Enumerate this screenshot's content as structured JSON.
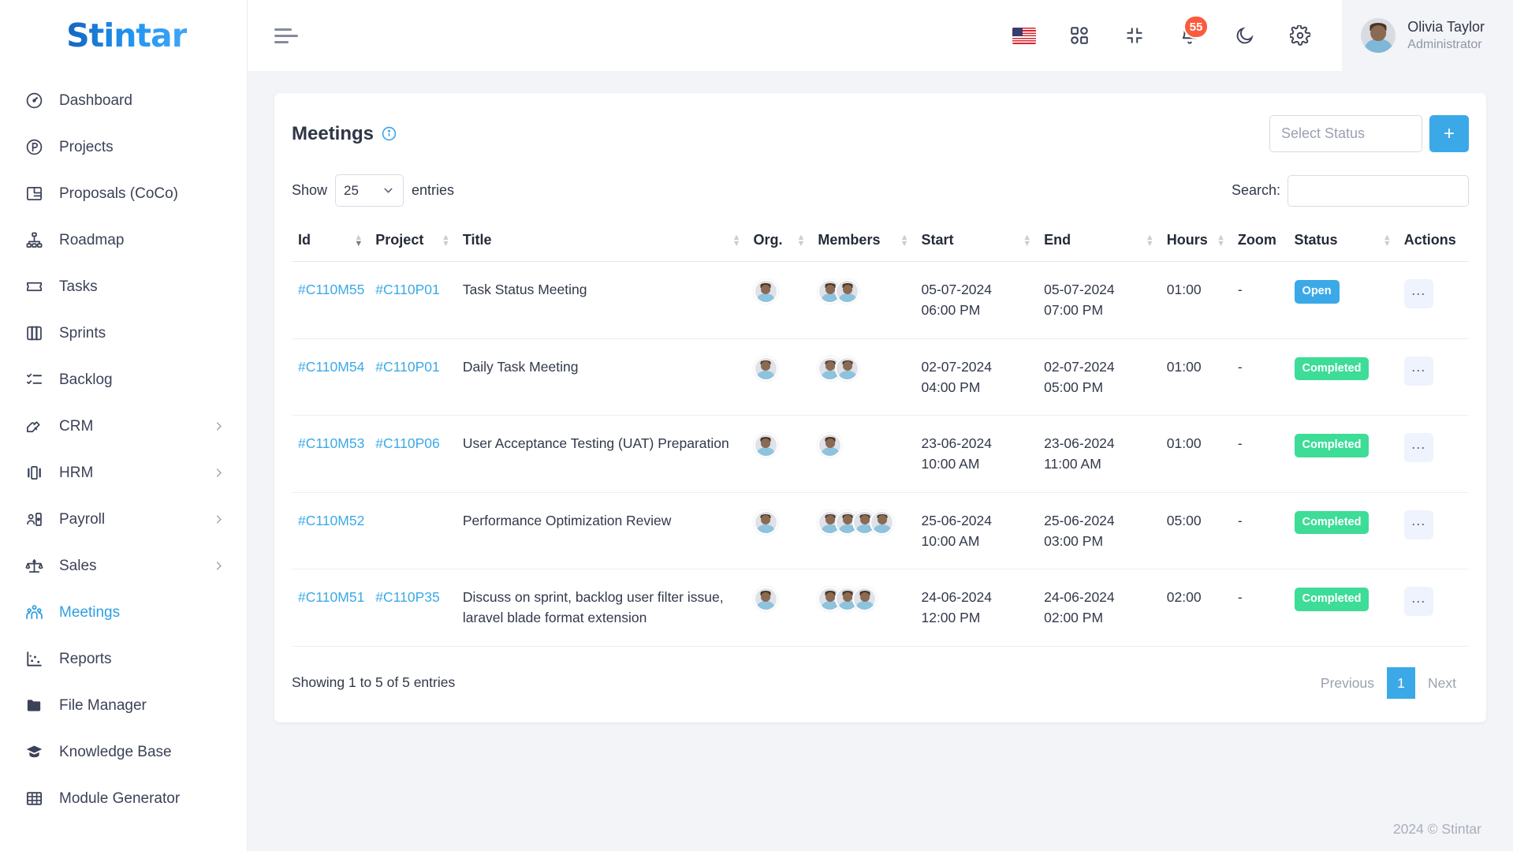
{
  "brand": {
    "name": "Stintar"
  },
  "sidebar": {
    "items": [
      {
        "label": "Dashboard",
        "icon": "gauge-icon",
        "has_submenu": false,
        "active": false
      },
      {
        "label": "Projects",
        "icon": "circle-p-icon",
        "has_submenu": false,
        "active": false
      },
      {
        "label": "Proposals (CoCo)",
        "icon": "layout-icon",
        "has_submenu": false,
        "active": false
      },
      {
        "label": "Roadmap",
        "icon": "sitemap-icon",
        "has_submenu": false,
        "active": false
      },
      {
        "label": "Tasks",
        "icon": "ticket-icon",
        "has_submenu": false,
        "active": false
      },
      {
        "label": "Sprints",
        "icon": "board-icon",
        "has_submenu": false,
        "active": false
      },
      {
        "label": "Backlog",
        "icon": "checklist-icon",
        "has_submenu": false,
        "active": false
      },
      {
        "label": "CRM",
        "icon": "handshake-icon",
        "has_submenu": true,
        "active": false
      },
      {
        "label": "HRM",
        "icon": "carousel-icon",
        "has_submenu": true,
        "active": false
      },
      {
        "label": "Payroll",
        "icon": "user-card-icon",
        "has_submenu": true,
        "active": false
      },
      {
        "label": "Sales",
        "icon": "scales-icon",
        "has_submenu": true,
        "active": false
      },
      {
        "label": "Meetings",
        "icon": "people-group-icon",
        "has_submenu": false,
        "active": true
      },
      {
        "label": "Reports",
        "icon": "scatter-chart-icon",
        "has_submenu": false,
        "active": false
      },
      {
        "label": "File Manager",
        "icon": "folder-icon",
        "has_submenu": false,
        "active": false
      },
      {
        "label": "Knowledge Base",
        "icon": "graduation-cap-icon",
        "has_submenu": false,
        "active": false
      },
      {
        "label": "Module Generator",
        "icon": "grid-table-icon",
        "has_submenu": false,
        "active": false
      }
    ]
  },
  "topbar": {
    "menu_toggle": "hamburger-icon",
    "language_flag": "us-flag-icon",
    "apps_icon": "apps-grid-icon",
    "fullscreen_icon": "compress-icon",
    "notifications_icon": "bell-icon",
    "notifications_count": "55",
    "theme_icon": "moon-icon",
    "settings_icon": "gear-icon",
    "user": {
      "name": "Olivia Taylor",
      "role": "Administrator"
    }
  },
  "card": {
    "title": "Meetings",
    "info_icon": "info-circle-icon",
    "select_status_placeholder": "Select Status",
    "add_label": "+"
  },
  "controls": {
    "show_label": "Show",
    "entries_value": "25",
    "entries_label": "entries",
    "search_label": "Search:",
    "search_value": "",
    "search_placeholder": ""
  },
  "table": {
    "columns": [
      {
        "label": "Id",
        "sortable": true,
        "sorted": "desc"
      },
      {
        "label": "Project",
        "sortable": true,
        "sorted": "none"
      },
      {
        "label": "Title",
        "sortable": true,
        "sorted": "none"
      },
      {
        "label": "Org.",
        "sortable": true,
        "sorted": "none"
      },
      {
        "label": "Members",
        "sortable": true,
        "sorted": "none"
      },
      {
        "label": "Start",
        "sortable": true,
        "sorted": "none"
      },
      {
        "label": "End",
        "sortable": true,
        "sorted": "none"
      },
      {
        "label": "Hours",
        "sortable": true,
        "sorted": "none"
      },
      {
        "label": "Zoom",
        "sortable": false,
        "sorted": "none"
      },
      {
        "label": "Status",
        "sortable": true,
        "sorted": "none"
      },
      {
        "label": "Actions",
        "sortable": false,
        "sorted": "none"
      }
    ],
    "rows": [
      {
        "id": "#C110M55",
        "project": "#C110P01",
        "title": "Task Status Meeting",
        "org_count": 1,
        "member_count": 2,
        "start_date": "05-07-2024",
        "start_time": "06:00 PM",
        "end_date": "05-07-2024",
        "end_time": "07:00 PM",
        "hours": "01:00",
        "zoom": "-",
        "status": "Open",
        "status_kind": "open",
        "actions": "..."
      },
      {
        "id": "#C110M54",
        "project": "#C110P01",
        "title": "Daily Task Meeting",
        "org_count": 1,
        "member_count": 2,
        "start_date": "02-07-2024",
        "start_time": "04:00 PM",
        "end_date": "02-07-2024",
        "end_time": "05:00 PM",
        "hours": "01:00",
        "zoom": "-",
        "status": "Completed",
        "status_kind": "completed",
        "actions": "..."
      },
      {
        "id": "#C110M53",
        "project": "#C110P06",
        "title": "User Acceptance Testing (UAT) Preparation",
        "org_count": 1,
        "member_count": 1,
        "start_date": "23-06-2024",
        "start_time": "10:00 AM",
        "end_date": "23-06-2024",
        "end_time": "11:00 AM",
        "hours": "01:00",
        "zoom": "-",
        "status": "Completed",
        "status_kind": "completed",
        "actions": "..."
      },
      {
        "id": "#C110M52",
        "project": "",
        "title": "Performance Optimization Review",
        "org_count": 1,
        "member_count": 4,
        "start_date": "25-06-2024",
        "start_time": "10:00 AM",
        "end_date": "25-06-2024",
        "end_time": "03:00 PM",
        "hours": "05:00",
        "zoom": "-",
        "status": "Completed",
        "status_kind": "completed",
        "actions": "..."
      },
      {
        "id": "#C110M51",
        "project": "#C110P35",
        "title": "Discuss on sprint, backlog user filter issue, laravel blade format extension",
        "org_count": 1,
        "member_count": 3,
        "start_date": "24-06-2024",
        "start_time": "12:00 PM",
        "end_date": "24-06-2024",
        "end_time": "02:00 PM",
        "hours": "02:00",
        "zoom": "-",
        "status": "Completed",
        "status_kind": "completed",
        "actions": "..."
      }
    ],
    "info_text": "Showing 1 to 5 of 5 entries",
    "pagination": {
      "previous": "Previous",
      "pages": [
        "1"
      ],
      "next": "Next",
      "current": "1"
    }
  },
  "footer": {
    "copyright": "2024 © Stintar"
  },
  "colors": {
    "accent": "#3ba9e8",
    "status_open": "#3ba9e8",
    "status_completed": "#3ddc97",
    "badge_red": "#fb5b3d",
    "sidebar_active": "#2e9fe0"
  }
}
